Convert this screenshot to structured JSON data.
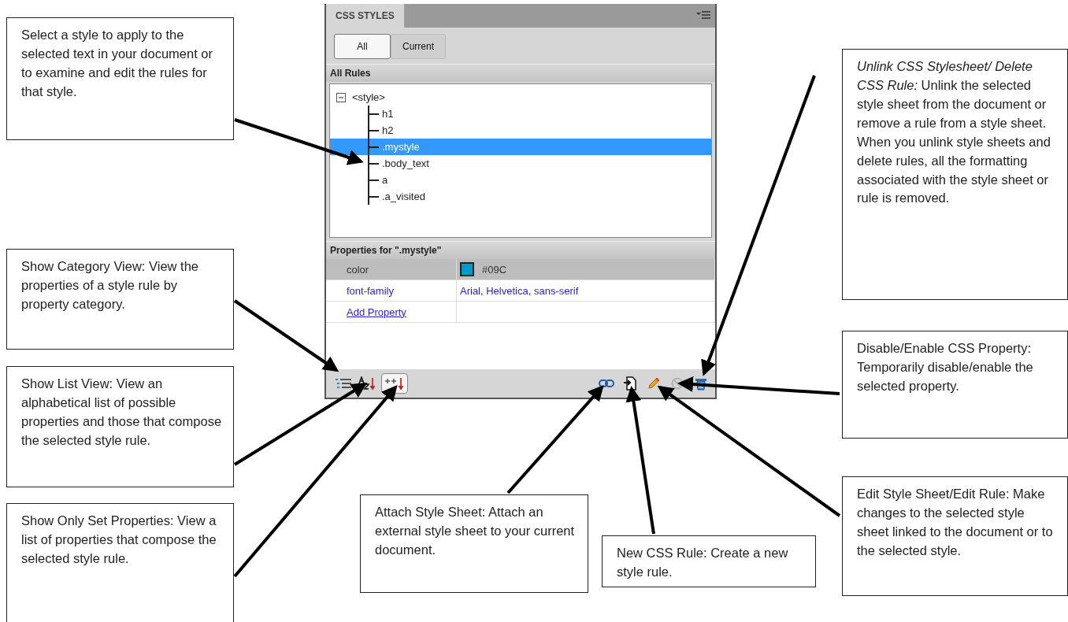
{
  "panel": {
    "title": "CSS STYLES",
    "toggle": [
      {
        "label": "All",
        "selected": true
      },
      {
        "label": "Current",
        "selected": false
      }
    ],
    "rules_header": "All Rules",
    "tree": [
      {
        "label": "<style>",
        "expanded": true,
        "selected": false,
        "children": [
          {
            "label": "h1",
            "selected": false
          },
          {
            "label": "h2",
            "selected": false
          },
          {
            "label": ".mystyle",
            "selected": true
          },
          {
            "label": ".body_text",
            "selected": false
          },
          {
            "label": "a",
            "selected": false
          },
          {
            "label": ".a_visited",
            "selected": false
          }
        ]
      }
    ],
    "properties_header": "Properties for \".mystyle\"",
    "properties": [
      {
        "kind": "swatch",
        "name": "color",
        "value": "#09C",
        "color": "#0099cc",
        "selected": true
      },
      {
        "kind": "text",
        "name": "font-family",
        "value": "Arial, Helvetica, sans-serif",
        "selected": false
      },
      {
        "kind": "link",
        "name": "Add Property",
        "selected": false
      }
    ],
    "toolbar_left": [
      {
        "kind": "category",
        "selected": false
      },
      {
        "kind": "az",
        "selected": false
      },
      {
        "kind": "setonly",
        "selected": true
      }
    ],
    "toolbar_right": [
      {
        "kind": "link",
        "disabled": false
      },
      {
        "kind": "new",
        "disabled": false
      },
      {
        "kind": "edit",
        "disabled": false
      },
      {
        "kind": "disable",
        "disabled": true
      },
      {
        "kind": "trash",
        "disabled": false
      }
    ]
  },
  "callouts": [
    {
      "text": "Select a style to apply to the selected text in your document or to examine and edit the rules for that style."
    },
    {
      "text": "Show Category View: View the properties of a style rule by property category."
    },
    {
      "text": "Show List View: View an alphabetical list of possible properties and those that compose the selected style rule."
    },
    {
      "text": "Show Only Set Properties: View a list of properties that compose the selected style rule."
    },
    {
      "text": "Attach Style Sheet: Attach an external style sheet to your current document."
    },
    {
      "text": "New CSS Rule: Create a new style rule."
    },
    {
      "text": "*Unlink CSS Stylesheet/ Delete CSS Rule:* Unlink the selected style sheet from the document or remove a rule from a style sheet. When you unlink style sheets and delete rules, all the formatting associated with the style sheet or rule is removed."
    },
    {
      "text": "Disable/Enable CSS Property: Temporarily disable/enable the selected property."
    },
    {
      "text": "Edit Style Sheet/Edit Rule: Make changes to the selected style sheet linked to the document or to the selected style."
    }
  ]
}
